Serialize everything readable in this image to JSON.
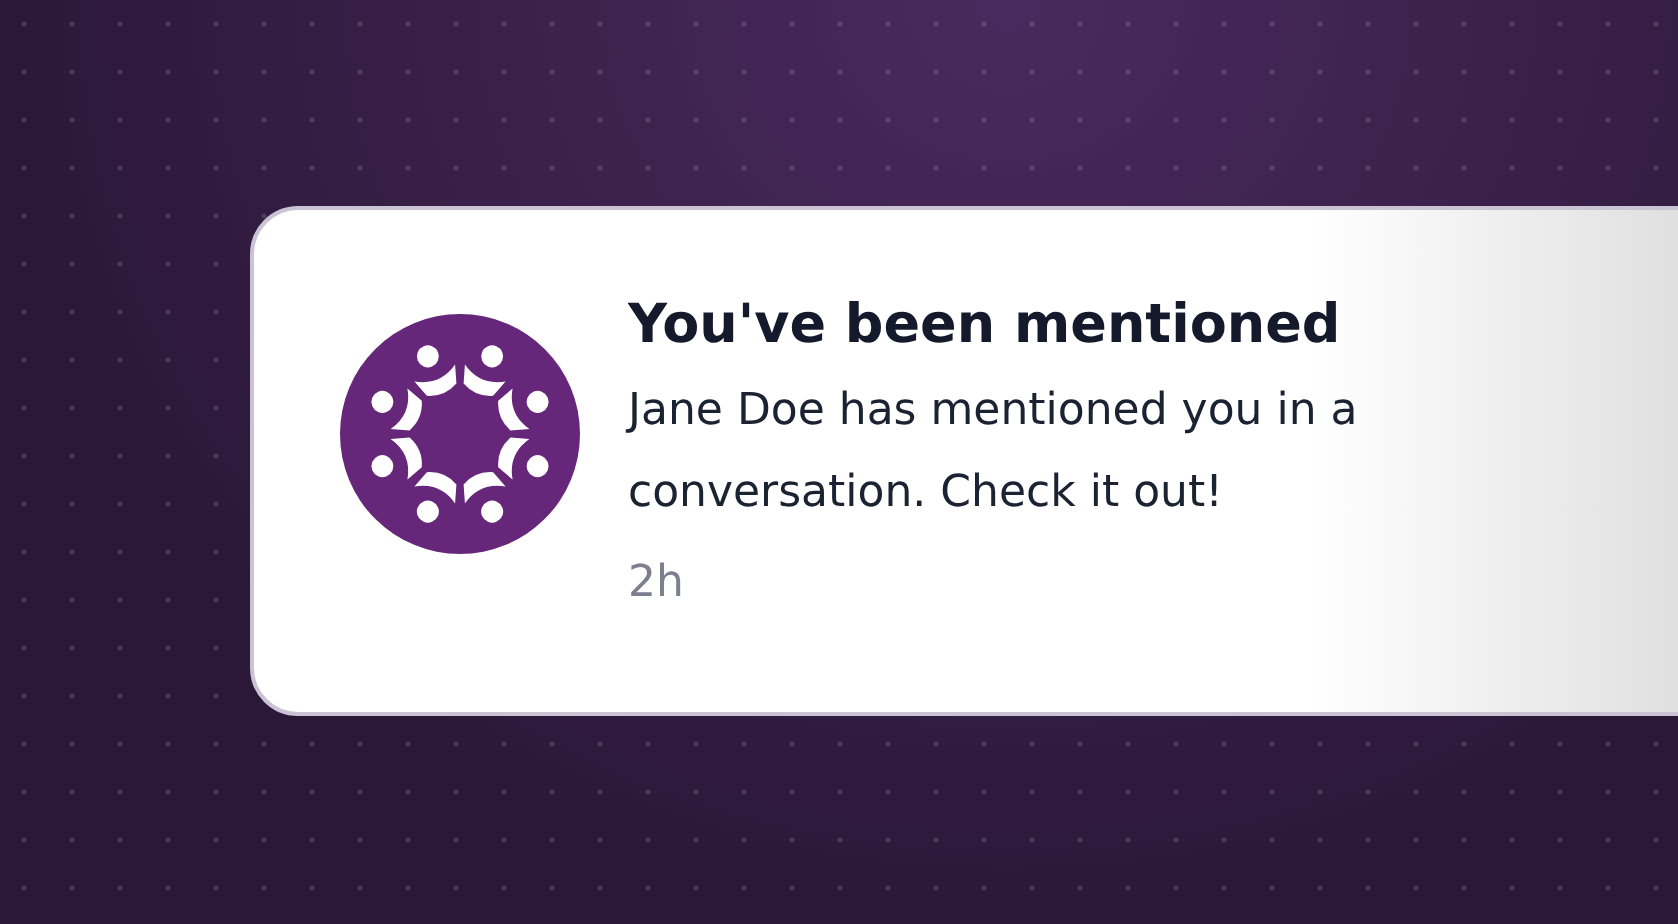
{
  "notification": {
    "title": "You've been mentioned",
    "message": "Jane Doe has mentioned you in a conversation. Check it out!",
    "time": "2h"
  }
}
